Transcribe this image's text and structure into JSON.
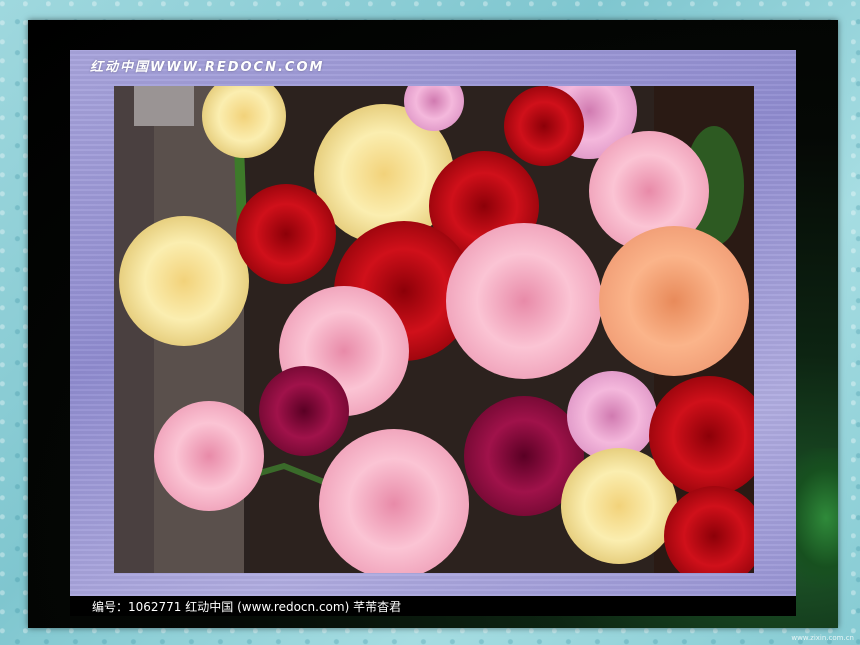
{
  "watermark_text": "红动中国WWW.REDOCN.COM",
  "caption_text": "编号：1062771    红动中国 (www.redocn.com)    芊芾杳君",
  "corner_mark": "www.zixin.com.cn",
  "colors": {
    "background": "#8ecfd6",
    "mat": "#a8a4dc",
    "frame": "#000000"
  }
}
